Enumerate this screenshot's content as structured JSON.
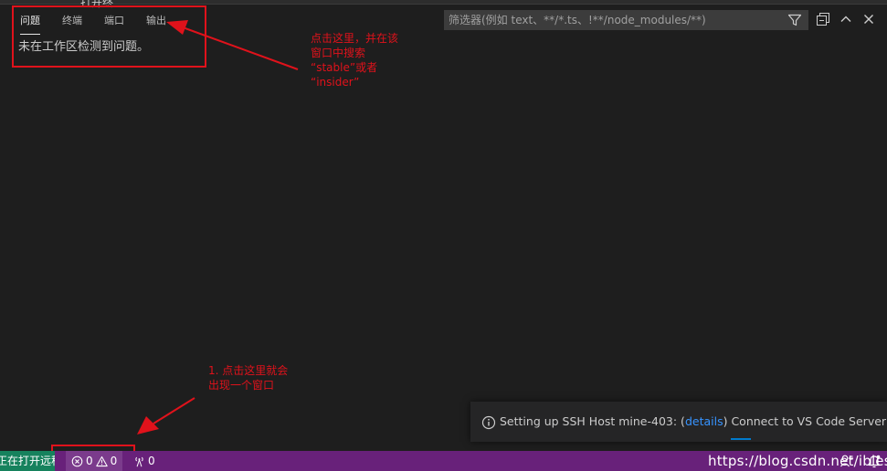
{
  "top_fragment": "打开终",
  "panel": {
    "tabs": [
      {
        "label": "问题",
        "active": true
      },
      {
        "label": "终端",
        "active": false
      },
      {
        "label": "端口",
        "active": false
      },
      {
        "label": "输出",
        "active": false
      }
    ],
    "message": "未在工作区检测到问题。",
    "filter_placeholder": "筛选器(例如 text、**/*.ts、!**/node_modules/**)"
  },
  "annotations": {
    "top": "点击这里，并在该\n窗口中搜索\n“stable”或者\n“insider”",
    "bottom": "1. 点击这里就会\n出现一个窗口"
  },
  "notification": {
    "prefix": "Setting up SSH Host mine-403: (",
    "link": "details",
    "suffix": ") Connect to VS Code Server - r..."
  },
  "statusbar": {
    "remote_label": "正在打开远程...",
    "errors": "0",
    "warnings": "0",
    "ports": "0",
    "watermark": "https://blog.csdn.net/ibless"
  },
  "colors": {
    "annotation": "#e0121b",
    "statusbar": "#68217a",
    "remote": "#16825d",
    "link": "#3794ff"
  }
}
